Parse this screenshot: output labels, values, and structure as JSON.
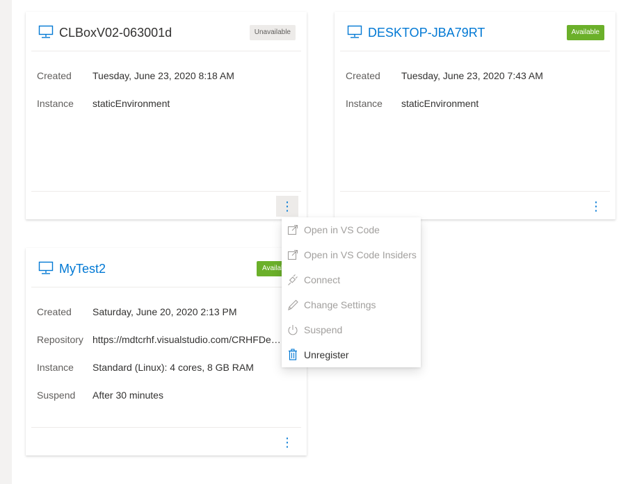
{
  "colors": {
    "link": "#0078d4",
    "available": "#6bb02a",
    "unavailable_bg": "#edebe9",
    "text": "#323130",
    "muted": "#605e5c",
    "disabled": "#a19f9d"
  },
  "cards": [
    {
      "title": "CLBoxV02-063001d",
      "badge": "Unavailable",
      "rows": [
        {
          "label": "Created",
          "value": "Tuesday, June 23, 2020 8:18 AM"
        },
        {
          "label": "Instance",
          "value": "staticEnvironment"
        }
      ],
      "icon": "computer-icon"
    },
    {
      "title": "DESKTOP-JBA79RT",
      "badge": "Available",
      "rows": [
        {
          "label": "Created",
          "value": "Tuesday, June 23, 2020 7:43 AM"
        },
        {
          "label": "Instance",
          "value": "staticEnvironment"
        }
      ],
      "icon": "computer-icon"
    },
    {
      "title": "MyTest2",
      "badge": "Available",
      "rows": [
        {
          "label": "Created",
          "value": "Saturday, June 20, 2020 2:13 PM"
        },
        {
          "label": "Repository",
          "value": "https://mdtcrhf.visualstudio.com/CRHFDev..."
        },
        {
          "label": "Instance",
          "value": "Standard (Linux): 4 cores, 8 GB RAM"
        },
        {
          "label": "Suspend",
          "value": "After 30 minutes"
        }
      ],
      "icon": "computer-icon"
    }
  ],
  "more_button": "⋮",
  "menu": [
    {
      "label": "Open in VS Code",
      "icon": "open-external-icon",
      "enabled": false
    },
    {
      "label": "Open in VS Code Insiders",
      "icon": "open-external-icon",
      "enabled": false
    },
    {
      "label": "Connect",
      "icon": "plug-icon",
      "enabled": false
    },
    {
      "label": "Change Settings",
      "icon": "pencil-icon",
      "enabled": false
    },
    {
      "label": "Suspend",
      "icon": "power-icon",
      "enabled": false
    },
    {
      "label": "Unregister",
      "icon": "trash-icon",
      "enabled": true
    }
  ]
}
